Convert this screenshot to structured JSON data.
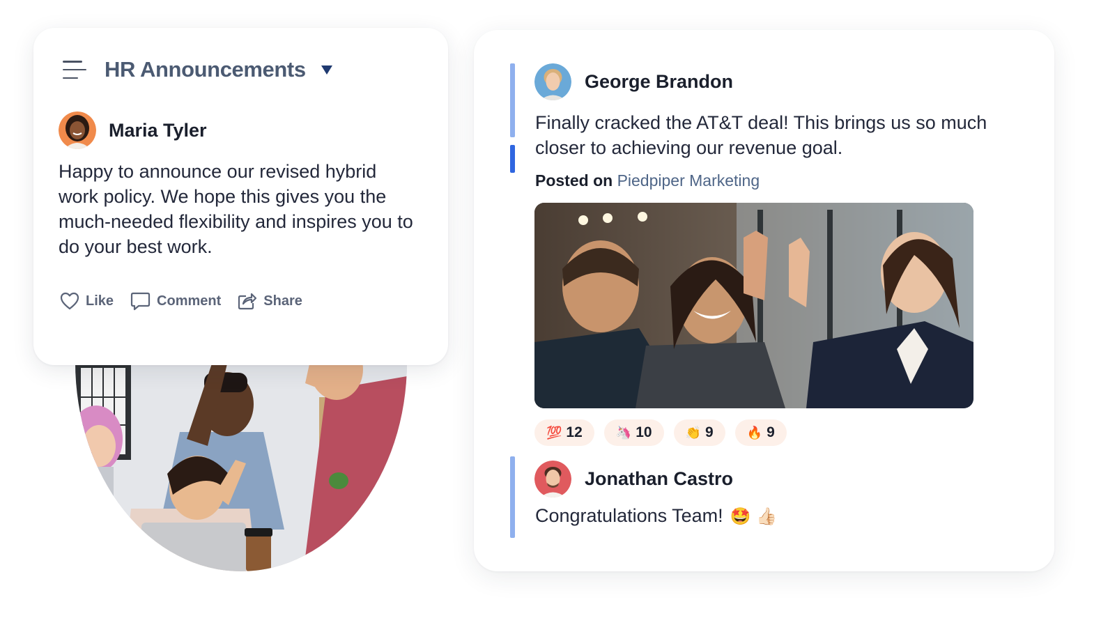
{
  "left_post": {
    "channel_title": "HR Announcements",
    "author_name": "Maria Tyler",
    "text": "Happy to announce our revised hybrid work policy. We hope this gives you the much-needed flexibility and inspires you to do your best work.",
    "actions": {
      "like": "Like",
      "comment": "Comment",
      "share": "Share"
    }
  },
  "right_post": {
    "author_name": "George Brandon",
    "text": "Finally cracked the AT&T deal! This brings us so much closer to achieving our revenue goal.",
    "posted_on_label": "Posted on",
    "posted_on_channel": "Piedpiper Marketing",
    "reactions": [
      {
        "emoji": "💯",
        "count": "12"
      },
      {
        "emoji": "🦄",
        "count": "10"
      },
      {
        "emoji": "👏",
        "count": "9"
      },
      {
        "emoji": "🔥",
        "count": "9"
      }
    ],
    "reply": {
      "author_name": "Jonathan Castro",
      "text": "Congratulations Team!",
      "emojis": "🤩 👍🏻"
    }
  },
  "colors": {
    "thread_bar": "#8fb0ee",
    "thread_bar_active": "#2f66e0",
    "reaction_bg": "#fdf0e9",
    "channel_link": "#4e6587"
  }
}
